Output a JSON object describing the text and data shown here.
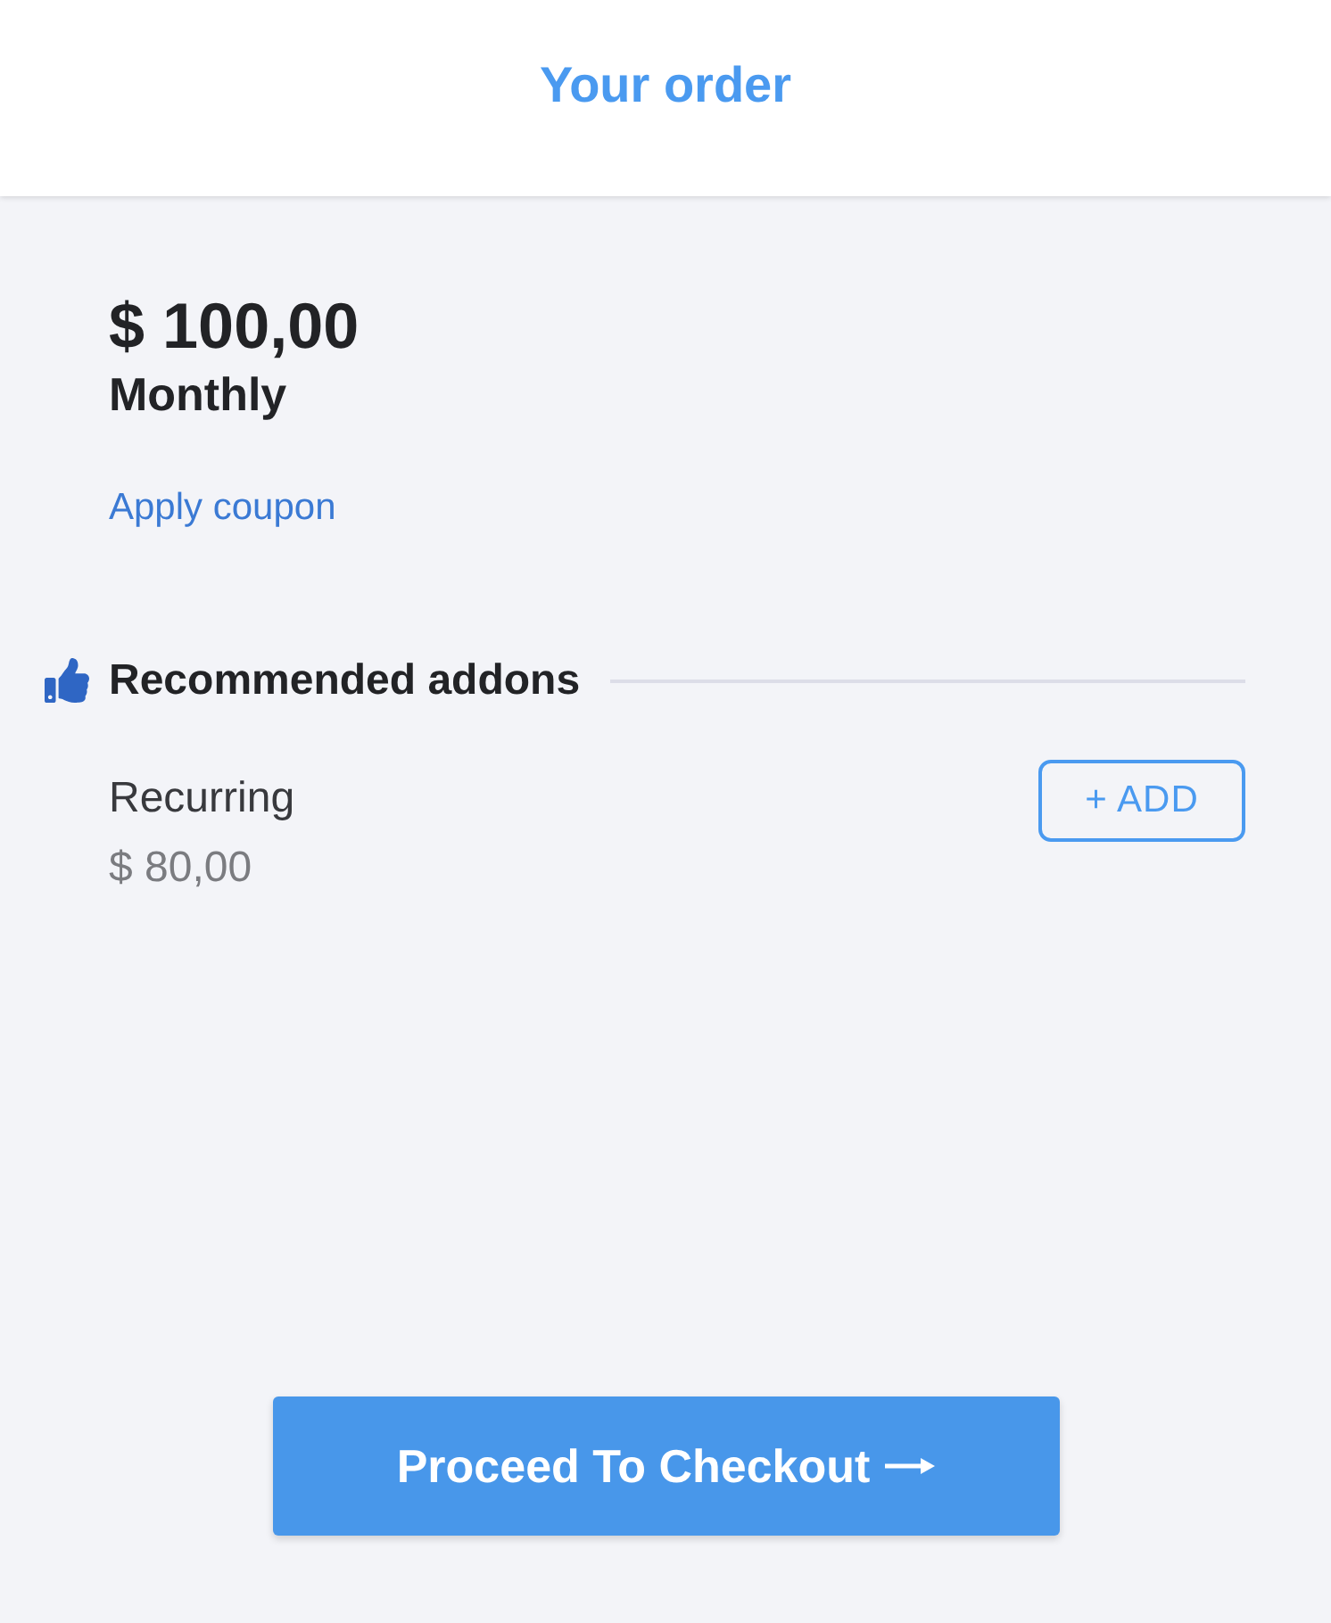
{
  "header": {
    "title": "Your order"
  },
  "plan": {
    "price": "$ 100,00",
    "period": "Monthly"
  },
  "coupon_link": "Apply coupon",
  "addons": {
    "title": "Recommended addons",
    "items": [
      {
        "name": "Recurring",
        "price": "$ 80,00",
        "button": "+ ADD"
      }
    ]
  },
  "checkout_button": {
    "label": "Proceed To Checkout"
  }
}
